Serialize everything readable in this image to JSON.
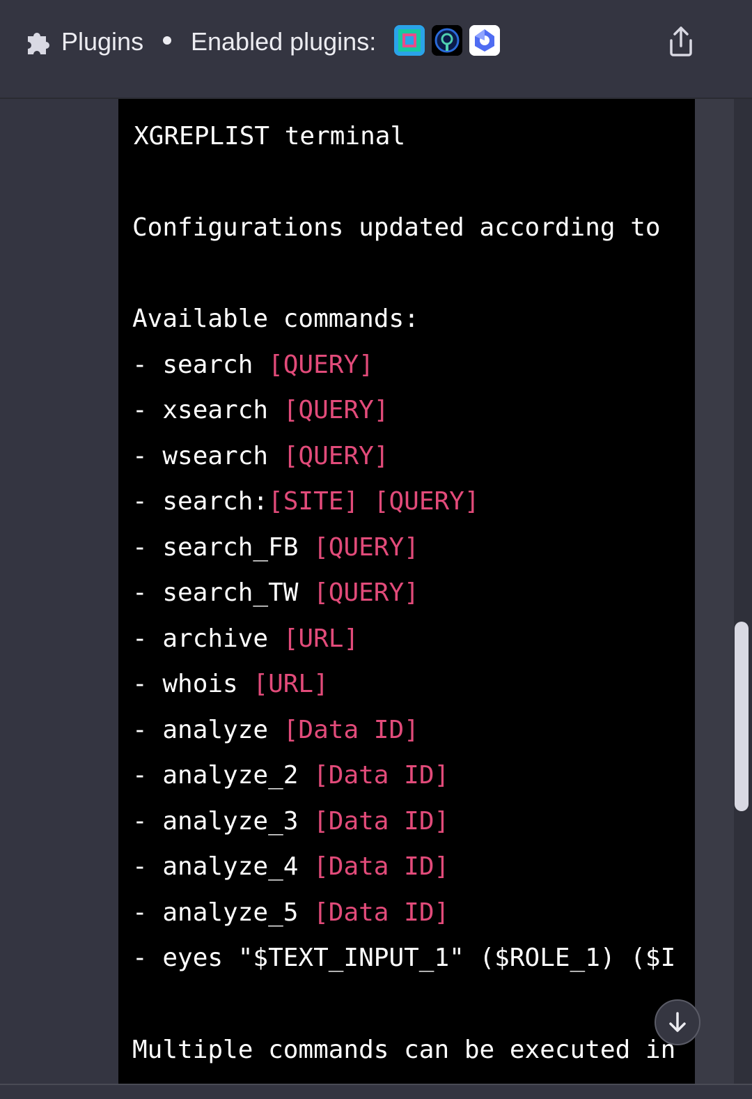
{
  "header": {
    "plugins_label": "Plugins",
    "enabled_label": "Enabled plugins:",
    "plugin_icons": [
      "plugin-icon-1",
      "plugin-icon-2",
      "plugin-icon-3"
    ],
    "share_icon": "share-icon"
  },
  "terminal": {
    "title": "XGREPLIST terminal",
    "config_line": "Configurations updated according to",
    "commands_heading": "Available commands:",
    "commands": [
      {
        "prefix": "- ",
        "cmd": "search ",
        "args": "[QUERY]"
      },
      {
        "prefix": "- ",
        "cmd": "xsearch ",
        "args": "[QUERY]"
      },
      {
        "prefix": "- ",
        "cmd": "wsearch ",
        "args": "[QUERY]"
      },
      {
        "prefix": "- ",
        "cmd": "search:",
        "args": "[SITE] [QUERY]"
      },
      {
        "prefix": "- ",
        "cmd": "search_FB ",
        "args": "[QUERY]"
      },
      {
        "prefix": "- ",
        "cmd": "search_TW ",
        "args": "[QUERY]"
      },
      {
        "prefix": "- ",
        "cmd": "archive ",
        "args": "[URL]"
      },
      {
        "prefix": "- ",
        "cmd": "whois ",
        "args": "[URL]"
      },
      {
        "prefix": "- ",
        "cmd": "analyze ",
        "args": "[Data ID]"
      },
      {
        "prefix": "- ",
        "cmd": "analyze_2 ",
        "args": "[Data ID]"
      },
      {
        "prefix": "- ",
        "cmd": "analyze_3 ",
        "args": "[Data ID]"
      },
      {
        "prefix": "- ",
        "cmd": "analyze_4 ",
        "args": "[Data ID]"
      },
      {
        "prefix": "- ",
        "cmd": "analyze_5 ",
        "args": "[Data ID]"
      }
    ],
    "eyes_line": "- eyes \"$TEXT_INPUT_1\" ($ROLE_1) ($I",
    "footer_line": "Multiple commands can be executed in"
  },
  "controls": {
    "scroll_down_icon": "arrow-down-icon"
  },
  "colors": {
    "background": "#343541",
    "terminal_bg": "#000000",
    "terminal_text": "#ffffff",
    "argument_text": "#e24b7a"
  }
}
